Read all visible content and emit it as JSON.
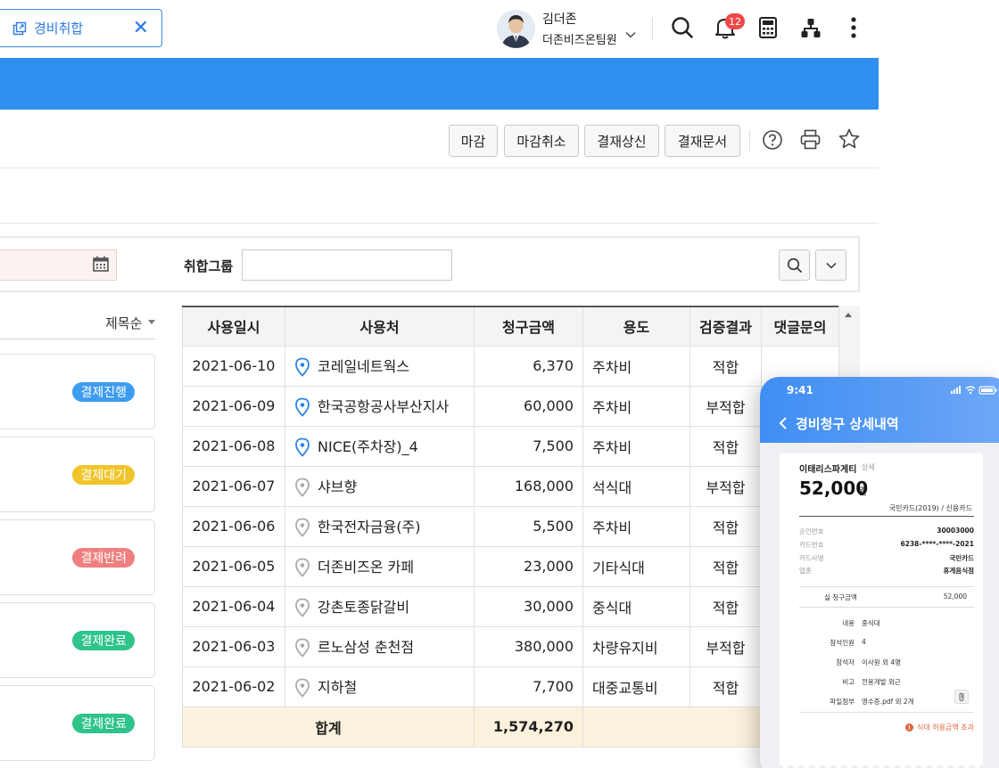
{
  "tab": {
    "label": "경비취합"
  },
  "user": {
    "name": "김더존",
    "team": "더존비즈온팀원"
  },
  "notifications": {
    "count": "12"
  },
  "actions": {
    "close": "마감",
    "cancel_close": "마감취소",
    "submit": "결재상신",
    "document": "결재문서"
  },
  "filter": {
    "group_label": "취합그룹",
    "group_value": ""
  },
  "list": {
    "sort_label": "제목순",
    "items": [
      {
        "status": "결제진행",
        "color": "#3d9cf0"
      },
      {
        "status": "결제대기",
        "color": "#f0c42a"
      },
      {
        "status": "결제반려",
        "color": "#f08080"
      },
      {
        "status": "결제완료",
        "color": "#2ec48a"
      },
      {
        "status": "결제완료",
        "color": "#2ec48a"
      }
    ]
  },
  "table": {
    "headers": [
      "사용일시",
      "사용처",
      "청구금액",
      "용도",
      "검증결과",
      "댓글문의"
    ],
    "rows": [
      {
        "date": "2021-06-10",
        "place": "코레일네트웍스",
        "amount": "6,370",
        "use": "주차비",
        "result": "적합",
        "ok": true,
        "pin": "blue"
      },
      {
        "date": "2021-06-09",
        "place": "한국공항공사부산지사",
        "amount": "60,000",
        "use": "주차비",
        "result": "부적합",
        "ok": false,
        "pin": "blue"
      },
      {
        "date": "2021-06-08",
        "place": "NICE(주차장)_4",
        "amount": "7,500",
        "use": "주차비",
        "result": "적합",
        "ok": true,
        "pin": "blue"
      },
      {
        "date": "2021-06-07",
        "place": "샤브향",
        "amount": "168,000",
        "use": "석식대",
        "result": "부적합",
        "ok": false,
        "pin": "gray"
      },
      {
        "date": "2021-06-06",
        "place": "한국전자금융(주)",
        "amount": "5,500",
        "use": "주차비",
        "result": "적합",
        "ok": true,
        "pin": "gray"
      },
      {
        "date": "2021-06-05",
        "place": "더존비즈온 카페",
        "amount": "23,000",
        "use": "기타식대",
        "result": "적합",
        "ok": true,
        "pin": "gray"
      },
      {
        "date": "2021-06-04",
        "place": "강촌토종닭갈비",
        "amount": "30,000",
        "use": "중식대",
        "result": "적합",
        "ok": true,
        "pin": "gray"
      },
      {
        "date": "2021-06-03",
        "place": "르노삼성 춘천점",
        "amount": "380,000",
        "use": "차량유지비",
        "result": "부적합",
        "ok": false,
        "pin": "gray"
      },
      {
        "date": "2021-06-02",
        "place": "지하철",
        "amount": "7,700",
        "use": "대중교통비",
        "result": "적합",
        "ok": true,
        "pin": "gray"
      }
    ],
    "total_label": "합계",
    "total_amount": "1,574,270"
  },
  "phone": {
    "time": "9:41",
    "title": "경비청구 상세내역",
    "merchant": "이태리스파게티",
    "detail_link": "상세",
    "amount": "52,000",
    "currency": "원",
    "card": "국민카드(2019) / 신용카드",
    "fields": [
      {
        "k": "승인번호",
        "v": "30003000"
      },
      {
        "k": "카드번호",
        "v": "6238-****-****-2021"
      },
      {
        "k": "카드사명",
        "v": "국민카드"
      },
      {
        "k": "업종",
        "v": "휴게음식점"
      }
    ],
    "claim_label": "실 청구금액",
    "claim_value": "52,000",
    "items": [
      {
        "k": "내용",
        "v": "중식대"
      },
      {
        "k": "참석인원",
        "v": "4"
      },
      {
        "k": "참석자",
        "v": "이사원 외 4명"
      },
      {
        "k": "비고",
        "v": "전용개발 외근"
      },
      {
        "k": "파일첨부",
        "v": "영수증.pdf 외 2개"
      }
    ],
    "warning": "식대 허용금액 초과"
  }
}
